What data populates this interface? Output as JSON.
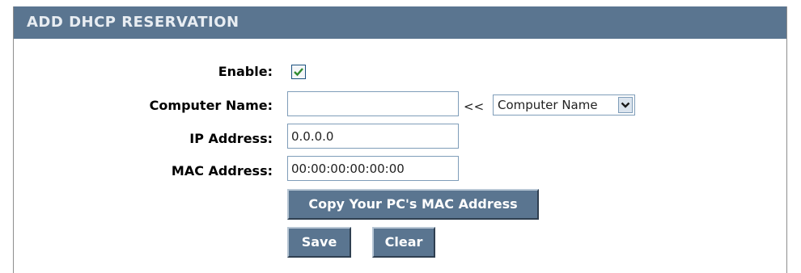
{
  "panel": {
    "title": "ADD DHCP RESERVATION"
  },
  "form": {
    "enable": {
      "label": "Enable:",
      "checked": true
    },
    "computer_name": {
      "label": "Computer Name:",
      "value": "",
      "arrows": "<<",
      "select_value": "Computer Name"
    },
    "ip_address": {
      "label": "IP Address:",
      "value": "0.0.0.0"
    },
    "mac_address": {
      "label": "MAC Address:",
      "value": "00:00:00:00:00:00"
    }
  },
  "buttons": {
    "copy_mac": "Copy Your PC's MAC Address",
    "save": "Save",
    "clear": "Clear"
  },
  "colors": {
    "header": "#5a7590",
    "button": "#5a7590",
    "checkmark": "#2f8a2f"
  },
  "icons": {
    "checkbox": "checkmark-icon",
    "dropdown": "chevron-down-icon"
  }
}
